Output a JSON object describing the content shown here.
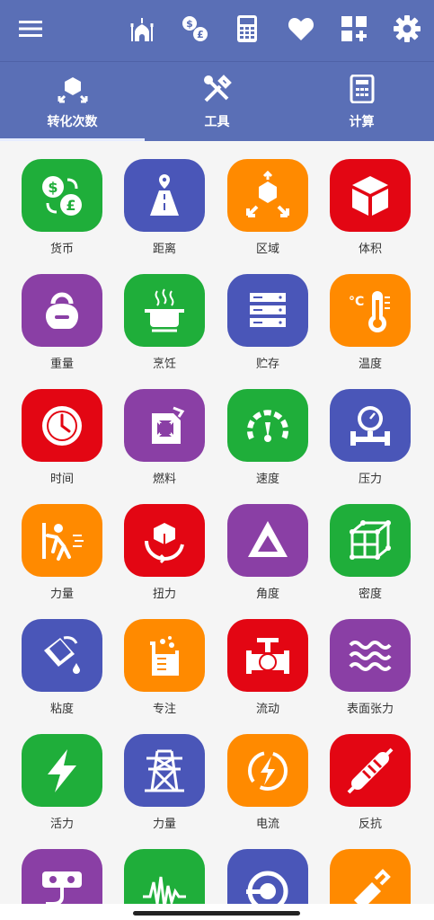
{
  "colors": {
    "header": "#5a6fb6",
    "green": "#1fae3a",
    "blue": "#4a56b8",
    "orange": "#ff8a00",
    "red": "#e30613",
    "purple": "#8a3fa5"
  },
  "topbar": {
    "icons": [
      "menu-icon",
      "mosque-icon",
      "currency-exchange-icon",
      "calculator-device-icon",
      "heart-icon",
      "add-widget-icon",
      "settings-icon"
    ]
  },
  "tabs": [
    {
      "label": "转化次数",
      "icon": "conversion-icon",
      "selected": true
    },
    {
      "label": "工具",
      "icon": "tools-icon"
    },
    {
      "label": "计算",
      "icon": "calculator-icon"
    }
  ],
  "items": [
    {
      "label": "货币",
      "icon": "currency-icon",
      "color": "#1fae3a"
    },
    {
      "label": "距离",
      "icon": "road-distance-icon",
      "color": "#4a56b8"
    },
    {
      "label": "区域",
      "icon": "area-expand-icon",
      "color": "#ff8a00"
    },
    {
      "label": "体积",
      "icon": "cube-icon",
      "color": "#e30613"
    },
    {
      "label": "重量",
      "icon": "kettlebell-icon",
      "color": "#8a3fa5"
    },
    {
      "label": "烹饪",
      "icon": "cooking-pot-icon",
      "color": "#1fae3a"
    },
    {
      "label": "贮存",
      "icon": "server-storage-icon",
      "color": "#4a56b8"
    },
    {
      "label": "温度",
      "icon": "thermometer-icon",
      "color": "#ff8a00"
    },
    {
      "label": "时间",
      "icon": "clock-icon",
      "color": "#e30613"
    },
    {
      "label": "燃料",
      "icon": "fuel-can-icon",
      "color": "#8a3fa5"
    },
    {
      "label": "速度",
      "icon": "speedometer-icon",
      "color": "#1fae3a"
    },
    {
      "label": "压力",
      "icon": "pressure-gauge-icon",
      "color": "#4a56b8"
    },
    {
      "label": "力量",
      "icon": "pushing-person-icon",
      "color": "#ff8a00"
    },
    {
      "label": "扭力",
      "icon": "torque-box-icon",
      "color": "#e30613"
    },
    {
      "label": "角度",
      "icon": "triangle-angle-icon",
      "color": "#8a3fa5"
    },
    {
      "label": "密度",
      "icon": "density-cube-icon",
      "color": "#1fae3a"
    },
    {
      "label": "粘度",
      "icon": "pouring-bucket-icon",
      "color": "#4a56b8"
    },
    {
      "label": "专注",
      "icon": "beaker-icon",
      "color": "#ff8a00"
    },
    {
      "label": "流动",
      "icon": "valve-pipe-icon",
      "color": "#e30613"
    },
    {
      "label": "表面张力",
      "icon": "waves-icon",
      "color": "#8a3fa5"
    },
    {
      "label": "活力",
      "icon": "lightning-icon",
      "color": "#1fae3a"
    },
    {
      "label": "力量",
      "icon": "power-tower-icon",
      "color": "#4a56b8"
    },
    {
      "label": "电流",
      "icon": "current-bolt-icon",
      "color": "#ff8a00"
    },
    {
      "label": "反抗",
      "icon": "resistor-icon",
      "color": "#e30613"
    },
    {
      "label": "",
      "icon": "power-strip-icon",
      "color": "#8a3fa5"
    },
    {
      "label": "",
      "icon": "waveform-icon",
      "color": "#1fae3a"
    },
    {
      "label": "",
      "icon": "plug-socket-icon",
      "color": "#4a56b8"
    },
    {
      "label": "",
      "icon": "capacitor-icon",
      "color": "#ff8a00"
    }
  ]
}
